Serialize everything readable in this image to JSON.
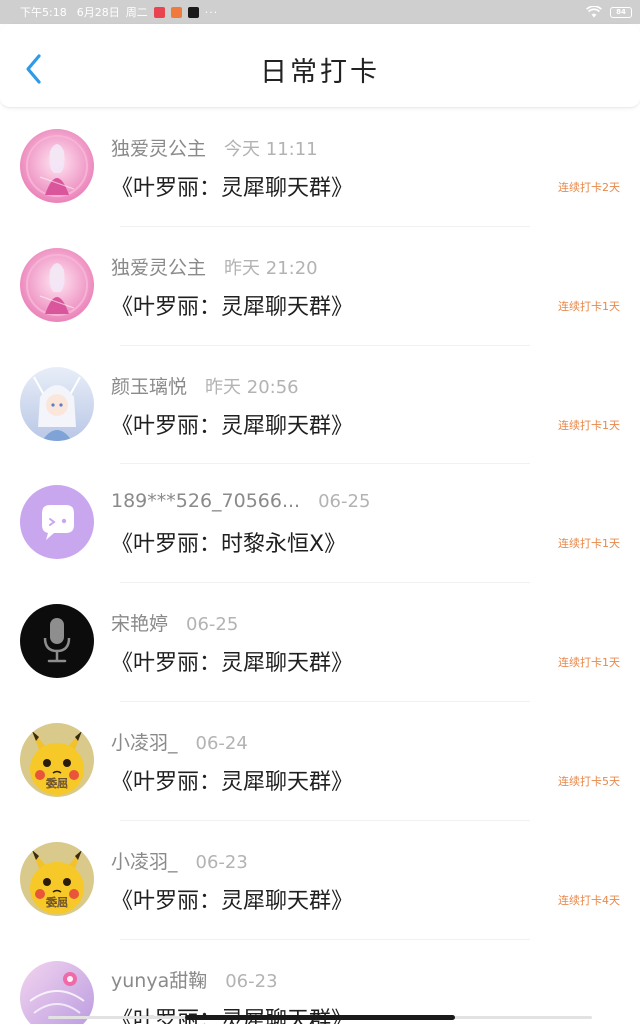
{
  "status_bar": {
    "time": "下午5:18",
    "date": "6月28日",
    "weekday": "周二",
    "more": "···",
    "battery": "84"
  },
  "header": {
    "title": "日常打卡"
  },
  "checkins": [
    {
      "name": "独爱灵公主",
      "time": "今天 11:11",
      "group": "《叶罗丽：灵犀聊天群》",
      "streak": "连续打卡2天",
      "avatar": "princess-avatar"
    },
    {
      "name": "独爱灵公主",
      "time": "昨天 21:20",
      "group": "《叶罗丽：灵犀聊天群》",
      "streak": "连续打卡1天",
      "avatar": "princess-avatar"
    },
    {
      "name": "颜玉璃悦",
      "time": "昨天 20:56",
      "group": "《叶罗丽：灵犀聊天群》",
      "streak": "连续打卡1天",
      "avatar": "fairy-avatar"
    },
    {
      "name": "189***526_70566...",
      "time": "06-25",
      "group": "《叶罗丽：时黎永恒X》",
      "streak": "连续打卡1天",
      "avatar": "chat-bubble-avatar"
    },
    {
      "name": "宋艳婷",
      "time": "06-25",
      "group": "《叶罗丽：灵犀聊天群》",
      "streak": "连续打卡1天",
      "avatar": "microphone-avatar"
    },
    {
      "name": "小凌羽_",
      "time": "06-24",
      "group": "《叶罗丽：灵犀聊天群》",
      "streak": "连续打卡5天",
      "avatar": "pikachu-avatar",
      "avatar_text": "委屈"
    },
    {
      "name": "小凌羽_",
      "time": "06-23",
      "group": "《叶罗丽：灵犀聊天群》",
      "streak": "连续打卡4天",
      "avatar": "pikachu-avatar",
      "avatar_text": "委屈"
    },
    {
      "name": "yunya甜鞠",
      "time": "06-23",
      "group": "《叶罗丽：灵犀聊天群》",
      "streak": "",
      "avatar": "angel-avatar"
    }
  ],
  "colors": {
    "accent": "#2f9be8",
    "streak": "#e8884a",
    "title": "#222222"
  }
}
